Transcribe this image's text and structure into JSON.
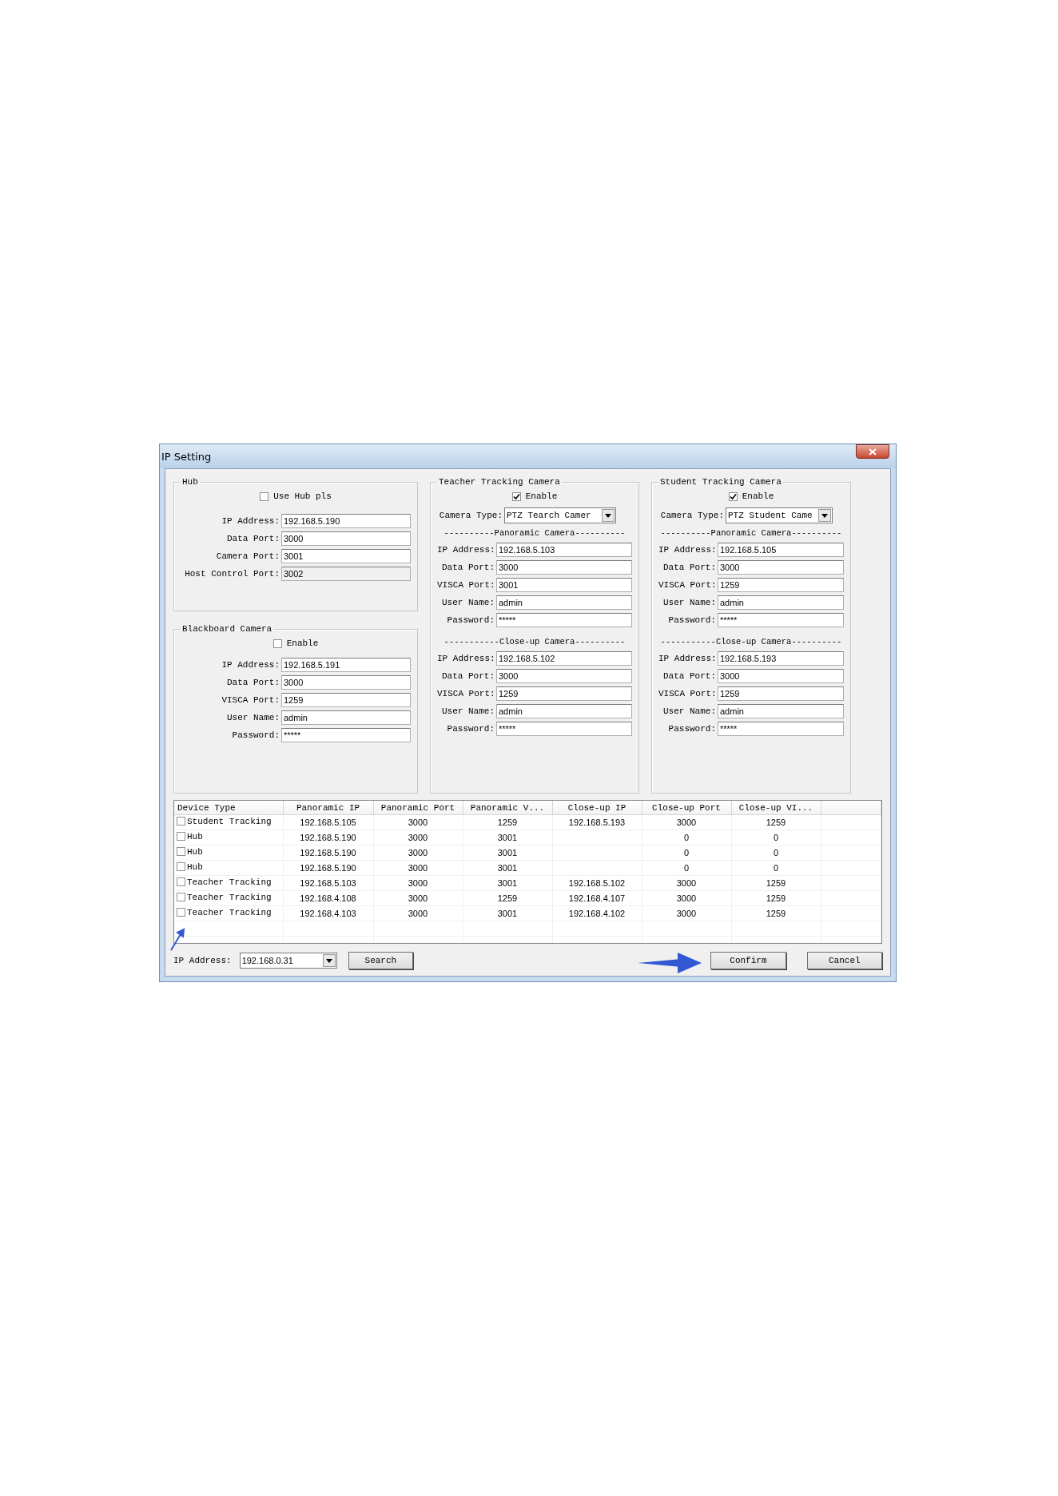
{
  "window": {
    "title": "IP Setting"
  },
  "hub": {
    "title": "Hub",
    "option": {
      "label": "Use Hub pls",
      "checked": false
    },
    "fields": [
      {
        "label": "IP Address:",
        "value": "192.168.5.190",
        "disabled": false
      },
      {
        "label": "Data Port:",
        "value": "3000",
        "disabled": false
      },
      {
        "label": "Camera Port:",
        "value": "3001",
        "disabled": false
      },
      {
        "label": "Host Control Port:",
        "value": "3002",
        "disabled": true
      }
    ]
  },
  "blackboard_camera": {
    "title": "Blackboard Camera",
    "option": {
      "label": "Enable",
      "checked": false
    },
    "fields": [
      {
        "label": "IP Address:",
        "value": "192.168.5.191",
        "disabled": false
      },
      {
        "label": "Data Port:",
        "value": "3000",
        "disabled": false
      },
      {
        "label": "VISCA Port:",
        "value": "1259",
        "disabled": false
      },
      {
        "label": "User Name:",
        "value": "admin",
        "disabled": false
      },
      {
        "label": "Password:",
        "value": "*****",
        "disabled": false
      }
    ]
  },
  "tracking_cameras": [
    {
      "title": "Teacher Tracking Camera",
      "option": {
        "label": "Enable",
        "checked": true
      },
      "camera_type": {
        "label": "Camera Type:",
        "value": "PTZ Tearch Camer"
      },
      "sections": [
        {
          "heading": "----------Panoramic Camera----------",
          "fields": [
            {
              "label": "IP Address:",
              "value": "192.168.5.103"
            },
            {
              "label": "Data Port:",
              "value": "3000"
            },
            {
              "label": "VISCA Port:",
              "value": "3001"
            },
            {
              "label": "User Name:",
              "value": "admin"
            },
            {
              "label": "Password:",
              "value": "*****"
            }
          ]
        },
        {
          "heading": "-----------Close-up Camera----------",
          "fields": [
            {
              "label": "IP Address:",
              "value": "192.168.5.102"
            },
            {
              "label": "Data Port:",
              "value": "3000"
            },
            {
              "label": "VISCA Port:",
              "value": "1259"
            },
            {
              "label": "User Name:",
              "value": "admin"
            },
            {
              "label": "Password:",
              "value": "*****"
            }
          ]
        }
      ]
    },
    {
      "title": "Student Tracking Camera",
      "option": {
        "label": "Enable",
        "checked": true
      },
      "camera_type": {
        "label": "Camera Type:",
        "value": "PTZ Student Came"
      },
      "sections": [
        {
          "heading": "----------Panoramic Camera----------",
          "fields": [
            {
              "label": "IP Address:",
              "value": "192.168.5.105"
            },
            {
              "label": "Data Port:",
              "value": "3000"
            },
            {
              "label": "VISCA Port:",
              "value": "1259"
            },
            {
              "label": "User Name:",
              "value": "admin"
            },
            {
              "label": "Password:",
              "value": "*****"
            }
          ]
        },
        {
          "heading": "-----------Close-up Camera----------",
          "fields": [
            {
              "label": "IP Address:",
              "value": "192.168.5.193"
            },
            {
              "label": "Data Port:",
              "value": "3000"
            },
            {
              "label": "VISCA Port:",
              "value": "1259"
            },
            {
              "label": "User Name:",
              "value": "admin"
            },
            {
              "label": "Password:",
              "value": "*****"
            }
          ]
        }
      ]
    }
  ],
  "device_table": {
    "columns": [
      "Device Type",
      "Panoramic IP",
      "Panoramic Port",
      "Panoramic V...",
      "Close-up IP",
      "Close-up Port",
      "Close-up VI..."
    ],
    "rows": [
      {
        "checked": false,
        "cells": [
          "Student Tracking",
          "192.168.5.105",
          "3000",
          "1259",
          "192.168.5.193",
          "3000",
          "1259"
        ]
      },
      {
        "checked": false,
        "cells": [
          "Hub",
          "192.168.5.190",
          "3000",
          "3001",
          null,
          "0",
          "0"
        ]
      },
      {
        "checked": false,
        "cells": [
          "Hub",
          "192.168.5.190",
          "3000",
          "3001",
          null,
          "0",
          "0"
        ]
      },
      {
        "checked": false,
        "cells": [
          "Hub",
          "192.168.5.190",
          "3000",
          "3001",
          null,
          "0",
          "0"
        ]
      },
      {
        "checked": false,
        "cells": [
          "Teacher Tracking",
          "192.168.5.103",
          "3000",
          "3001",
          "192.168.5.102",
          "3000",
          "1259"
        ]
      },
      {
        "checked": false,
        "cells": [
          "Teacher Tracking",
          "192.168.4.108",
          "3000",
          "1259",
          "192.168.4.107",
          "3000",
          "1259"
        ]
      },
      {
        "checked": false,
        "cells": [
          "Teacher Tracking",
          "192.168.4.103",
          "3000",
          "3001",
          "192.168.4.102",
          "3000",
          "1259"
        ]
      }
    ]
  },
  "footer": {
    "ip_label": "IP Address:",
    "ip_value": "192.168.0.31",
    "search": "Search",
    "confirm": "Confirm",
    "cancel": "Cancel"
  }
}
